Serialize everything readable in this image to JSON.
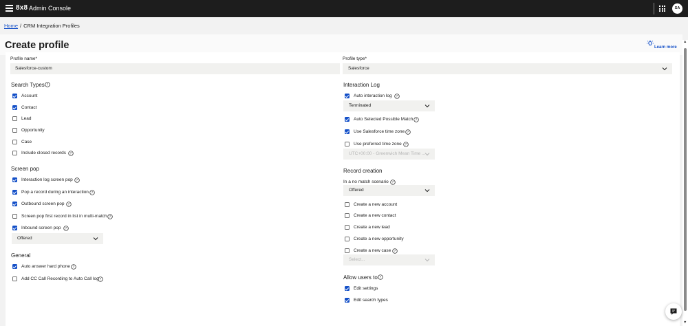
{
  "topbar": {
    "brand": "8x8",
    "title": "Admin Console",
    "user_initials": "SA"
  },
  "breadcrumb": {
    "home": "Home",
    "separator": "/",
    "current": "CRM Integration Profiles"
  },
  "page": {
    "title": "Create profile",
    "learn_more": "Learn more"
  },
  "form": {
    "profile_name_label": "Profile name*",
    "profile_name_value": "Salesforce-custom",
    "profile_type_label": "Profile type*",
    "profile_type_value": "Salesforce"
  },
  "search_types": {
    "title": "Search Types",
    "items": [
      {
        "label": "Account",
        "checked": true
      },
      {
        "label": "Contact",
        "checked": true
      },
      {
        "label": "Lead",
        "checked": false
      },
      {
        "label": "Opportunity",
        "checked": false
      },
      {
        "label": "Case",
        "checked": false
      },
      {
        "label": "Include closed records",
        "checked": false
      }
    ]
  },
  "screen_pop": {
    "title": "Screen pop",
    "items": [
      {
        "label": "Interaction log screen pop",
        "checked": true
      },
      {
        "label": "Pop a record during an interaction",
        "checked": true
      },
      {
        "label": "Outbound screen pop",
        "checked": true
      },
      {
        "label": "Screen pop first record in list in multi-match",
        "checked": false
      },
      {
        "label": "Inbound screen pop",
        "checked": true
      }
    ],
    "inbound_select": "Offered"
  },
  "general": {
    "title": "General",
    "items": [
      {
        "label": "Auto answer hard phone",
        "checked": true
      },
      {
        "label": "Add CC Call Recording to Auto Call log",
        "checked": false
      }
    ]
  },
  "interaction_log": {
    "title": "Interaction Log",
    "auto_log_label": "Auto interaction log",
    "auto_log_checked": true,
    "auto_log_select": "Terminated",
    "auto_selected_label": "Auto Selected Possible Match",
    "auto_selected_checked": true,
    "sf_timezone_label": "Use Salesforce time zone",
    "sf_timezone_checked": true,
    "preferred_tz_label": "Use preferred time zone",
    "preferred_tz_checked": false,
    "timezone_select": "UTC+00:00 - Greenwich Mean Time ..."
  },
  "record_creation": {
    "title": "Record creation",
    "no_match_label": "In a no match scenario",
    "no_match_select": "Offered",
    "items": [
      {
        "label": "Create a new account",
        "checked": false
      },
      {
        "label": "Create a new contact",
        "checked": false
      },
      {
        "label": "Create a new lead",
        "checked": false
      },
      {
        "label": "Create a new opportunity",
        "checked": false
      },
      {
        "label": "Create a new case",
        "checked": false
      }
    ],
    "case_select_placeholder": "Select..."
  },
  "allow_users": {
    "title": "Allow users to",
    "items": [
      {
        "label": "Edit settings",
        "checked": true
      },
      {
        "label": "Edit search types",
        "checked": true
      }
    ]
  },
  "colors": {
    "accent": "#1450c8",
    "topbar": "#1d1d1d",
    "field_bg": "#f1f1ef"
  }
}
